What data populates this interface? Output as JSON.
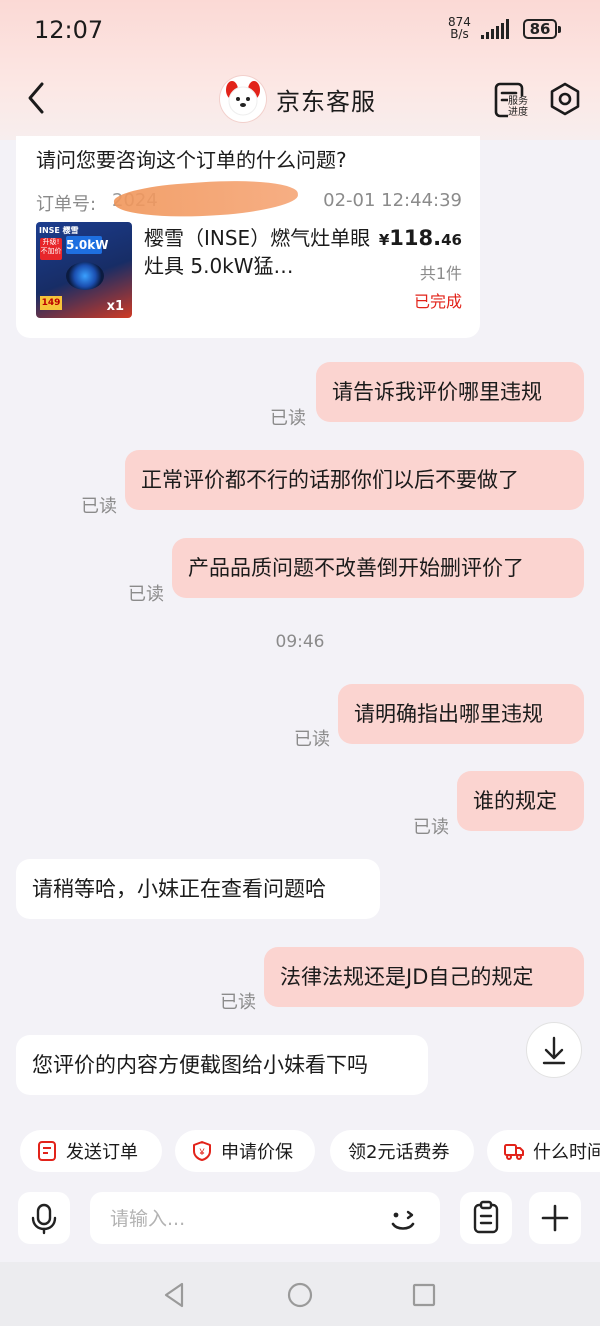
{
  "status": {
    "time": "12:07",
    "net_speed": "874",
    "net_unit": "B/s",
    "battery": "86"
  },
  "header": {
    "title": "京东客服",
    "service_label_1": "服务",
    "service_label_2": "进度"
  },
  "order_card": {
    "question": "请问您要咨询这个订单的什么问题?",
    "order_label": "订单号:",
    "order_number_visible": "2024",
    "order_time": "02-01 12:44:39",
    "thumb": {
      "brand": "INSE 樱雪",
      "power": "5.0kW",
      "badge": "升级!不加价",
      "price_tag": "149",
      "qty": "x1"
    },
    "product_name": "樱雪（INSE）燃气灶单眼灶具 5.0kW猛…",
    "price_currency": "¥",
    "price_int": "118.",
    "price_dec": "46",
    "count": "共1件",
    "status": "已完成"
  },
  "messages": [
    {
      "from": "me",
      "text": "请告诉我评价哪里违规",
      "read": "已读"
    },
    {
      "from": "me",
      "text": "正常评价都不行的话那你们以后不要做了",
      "read": "已读"
    },
    {
      "from": "me",
      "text": "产品品质问题不改善倒开始删评价了",
      "read": "已读"
    },
    {
      "type": "time",
      "text": "09:46"
    },
    {
      "from": "me",
      "text": "请明确指出哪里违规",
      "read": "已读"
    },
    {
      "from": "me",
      "text": "谁的规定",
      "read": "已读"
    },
    {
      "from": "them",
      "text": "请稍等哈，小妹正在查看问题哈"
    },
    {
      "from": "me",
      "text": "法律法规还是JD自己的规定",
      "read": "已读"
    },
    {
      "from": "them",
      "text": "您评价的内容方便截图给小妹看下吗"
    }
  ],
  "quick_actions": [
    {
      "label": "发送订单",
      "icon": "order-icon"
    },
    {
      "label": "申请价保",
      "icon": "price-protect-icon"
    },
    {
      "label": "领2元话费券",
      "icon": ""
    },
    {
      "label": "什么时间",
      "icon": "truck-icon"
    }
  ],
  "input": {
    "placeholder": "请输入..."
  },
  "colors": {
    "my_bubble": "#fbd4d0",
    "their_bubble": "#ffffff",
    "accent_red": "#e2231a",
    "background": "#f3f2f7"
  }
}
